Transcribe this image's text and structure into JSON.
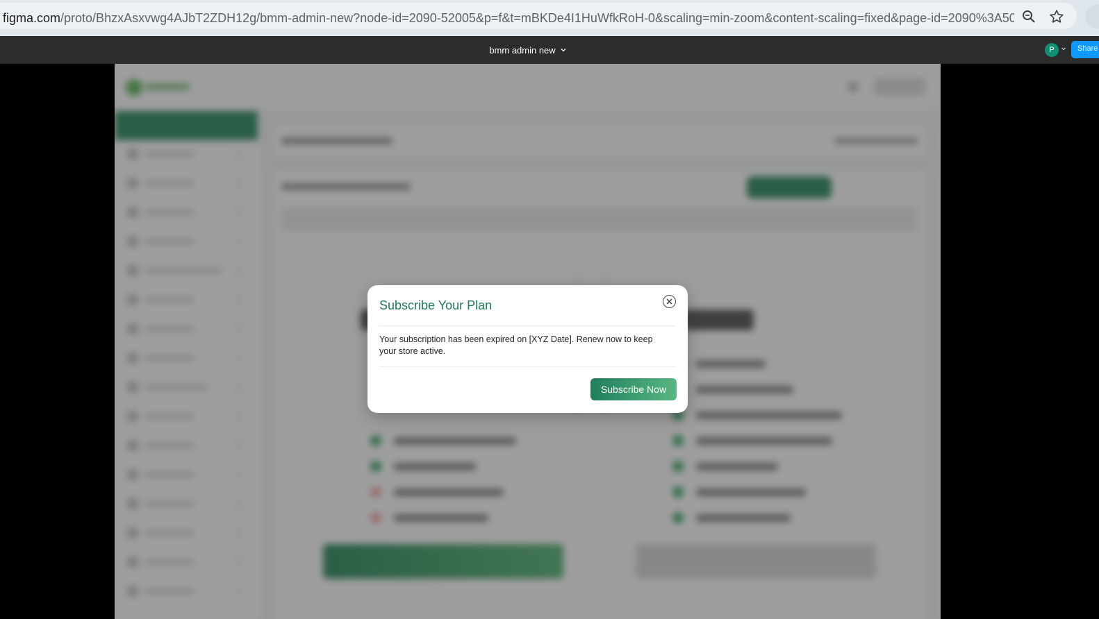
{
  "browser": {
    "url_host": "figma.com",
    "url_rest": "/proto/BhzxAsxvwg4AJbT2ZDH12g/bmm-admin-new?node-id=2090-52005&p=f&t=mBKDe4I1HuWfkRoH-0&scaling=min-zoom&content-scaling=fixed&page-id=2090%3A509...",
    "zoom_icon": "zoom-icon",
    "bookmark_icon": "star-icon"
  },
  "figma": {
    "file_name": "bmm admin new",
    "avatar_initial": "P",
    "share_label": "Share"
  },
  "modal": {
    "title": "Subscribe Your Plan",
    "message": "Your subscription has been expired on [XYZ Date]. Renew now to keep your store active.",
    "button_label": "Subscribe Now",
    "close_icon": "close-icon"
  },
  "colors": {
    "accent": "#1f7a55",
    "figma_bar": "#2c2c2c",
    "share_blue": "#0d99ff"
  }
}
